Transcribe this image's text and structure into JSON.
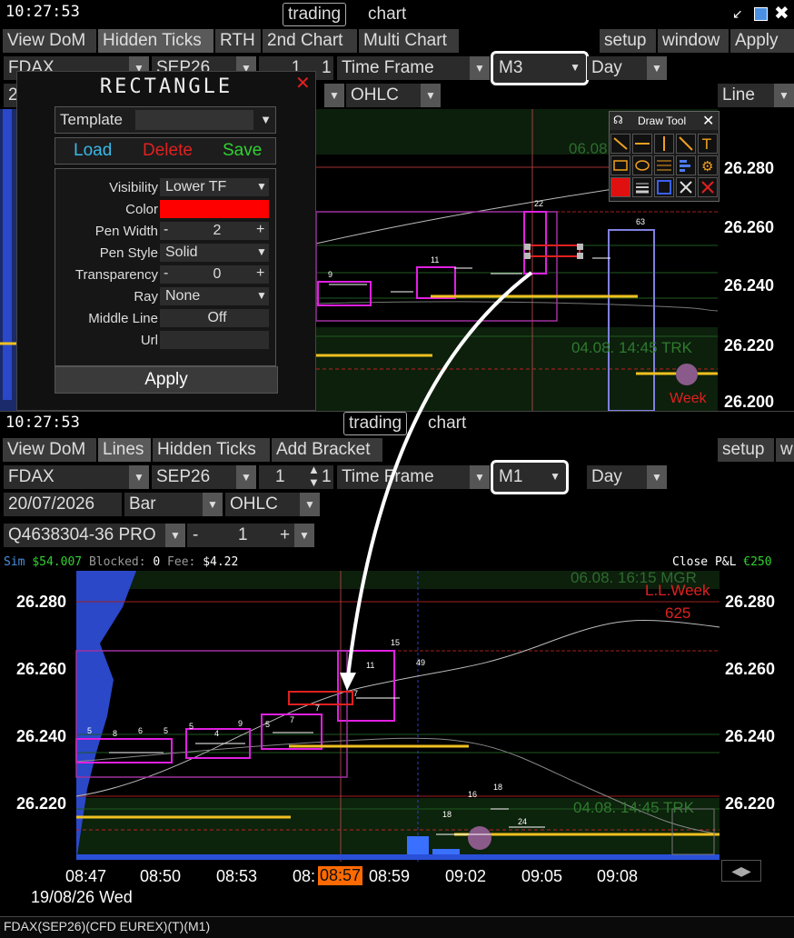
{
  "top": {
    "clock": "10:27:53",
    "title_left": "trading",
    "title_right": "chart",
    "tabs": [
      "View DoM",
      "Hidden Ticks",
      "RTH",
      "2nd Chart",
      "Multi Chart"
    ],
    "right_buttons": [
      "setup",
      "window",
      "Apply"
    ],
    "symbol": "FDAX",
    "expiry": "SEP26",
    "qty": "1",
    "qty_suffix": "1",
    "timeframe_label": "Time Frame",
    "timeframe_value": "M3",
    "period": "Day",
    "row2_num": "2",
    "style": "OHLC",
    "line_type": "Line",
    "price_labels": [
      "26.280",
      "26.260",
      "26.240",
      "26.220",
      "26.200"
    ],
    "overlay_texts": {
      "top_ghost": "06.08",
      "trk": "04.08. 14:45 TRK",
      "week": "Week"
    },
    "counts": {
      "c9": "9",
      "c11": "11",
      "c22": "22",
      "c63": "63"
    }
  },
  "rect_dialog": {
    "title": "RECTANGLE",
    "template_label": "Template",
    "template_value": "",
    "load": "Load",
    "delete": "Delete",
    "save": "Save",
    "fields": [
      {
        "label": "Visibility",
        "value": "Lower TF"
      },
      {
        "label": "Color",
        "value": ""
      },
      {
        "label": "Pen Width",
        "value": "2"
      },
      {
        "label": "Pen Style",
        "value": "Solid"
      },
      {
        "label": "Transparency",
        "value": "0"
      },
      {
        "label": "Ray",
        "value": "None"
      },
      {
        "label": "Middle Line",
        "value": "Off"
      },
      {
        "label": "Url",
        "value": ""
      }
    ],
    "apply": "Apply",
    "color_value": "#ff0000"
  },
  "draw_tool": {
    "title": "Draw Tool"
  },
  "bottom": {
    "clock": "10:27:53",
    "title_left": "trading",
    "title_right": "chart",
    "tabs": [
      "View DoM",
      "Lines",
      "Hidden Ticks",
      "Add Bracket"
    ],
    "right_buttons": [
      "setup",
      "w"
    ],
    "symbol": "FDAX",
    "expiry": "SEP26",
    "qty": "1",
    "qty_suffix": "1",
    "timeframe_label": "Time Frame",
    "timeframe_value": "M1",
    "period": "Day",
    "date": "20/07/2026",
    "chart_type": "Bar",
    "style": "OHLC",
    "order_id": "Q4638304-36 PRO",
    "order_qty": "1",
    "account": {
      "sim": "Sim",
      "balance": "$54.007",
      "blocked_label": "Blocked:",
      "blocked": "0",
      "fee_label": "Fee:",
      "fee": "$4.22",
      "close": "Close",
      "pl": "P&L",
      "pl_value": "€250"
    },
    "price_labels": [
      "26.280",
      "26.260",
      "26.240",
      "26.220"
    ],
    "time_labels": [
      "08:47",
      "08:50",
      "08:53",
      "08:",
      "08:57",
      "08:59",
      "09:02",
      "09:05",
      "09:08"
    ],
    "date_label": "19/08/26 Wed",
    "overlay_texts": {
      "top_ghost": "06.08. 16:15 MGR",
      "llweek": "L.L.Week",
      "l625": "625",
      "trk": "04.08. 14:45 TRK"
    },
    "counts": [
      "5",
      "8",
      "6",
      "5",
      "5",
      "4",
      "9",
      "5",
      "7",
      "7",
      "15",
      "11",
      "7",
      "49",
      "18",
      "16",
      "18",
      "24"
    ],
    "status": "FDAX(SEP26)(CFD EUREX)(T)(M1)"
  }
}
